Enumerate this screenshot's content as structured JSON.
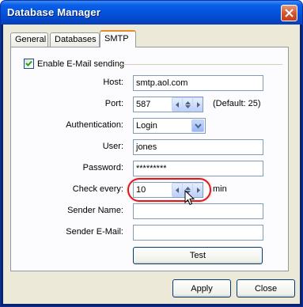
{
  "window": {
    "title": "Database Manager"
  },
  "tabs": [
    {
      "label": "General",
      "active": false
    },
    {
      "label": "Databases",
      "active": false
    },
    {
      "label": "SMTP",
      "active": true
    }
  ],
  "smtp": {
    "enable_label": "Enable E-Mail sending",
    "enable_checked": true,
    "host_label": "Host:",
    "host_value": "smtp.aol.com",
    "port_label": "Port:",
    "port_value": "587",
    "port_default": "(Default: 25)",
    "auth_label": "Authentication:",
    "auth_value": "Login",
    "user_label": "User:",
    "user_value": "jones",
    "password_label": "Password:",
    "password_value": "*********",
    "check_label": "Check every:",
    "check_value": "10",
    "check_unit": "min",
    "sender_name_label": "Sender Name:",
    "sender_name_value": "",
    "sender_email_label": "Sender E-Mail:",
    "sender_email_value": "",
    "test_label": "Test"
  },
  "footer": {
    "apply_label": "Apply",
    "close_label": "Close"
  },
  "colors": {
    "title_bar": "#0453dc",
    "highlight_oval": "#e01818",
    "tab_accent": "#e68b2c"
  }
}
